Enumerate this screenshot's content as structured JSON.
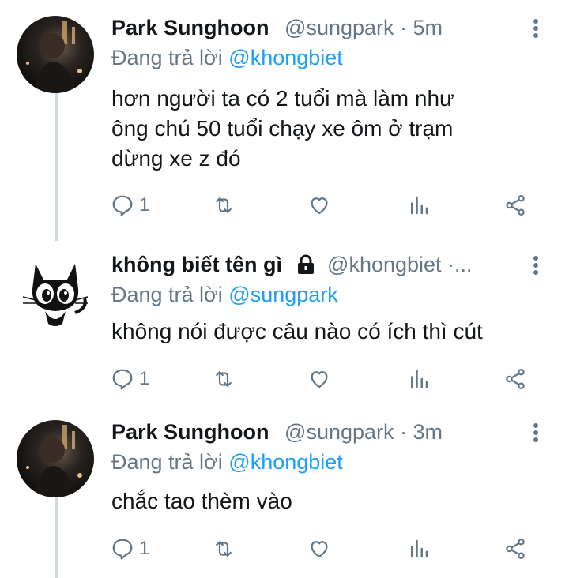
{
  "colors": {
    "accent": "#1da1f2",
    "muted": "#657786",
    "text": "#14171a",
    "thread": "#cfd9de"
  },
  "tweets": [
    {
      "name": "Park Sunghoon",
      "handle": "@sungpark · 5m",
      "reply_prefix": "Đang trả lời",
      "reply_to": "@khongbiet",
      "lines": [
        "hơn người ta có 2 tuổi mà làm như",
        "ông chú 50 tuổi chạy xe ôm ở trạm",
        "dừng xe z đó"
      ],
      "reply_count": "1",
      "avatar": "photo"
    },
    {
      "name": "không biết tên gì",
      "handle": "@khongbiet ·...",
      "reply_prefix": "Đang trả lời",
      "reply_to": "@sungpark",
      "lines": [
        "không nói được câu nào có ích thì cút"
      ],
      "reply_count": "1",
      "avatar": "cat",
      "locked_icon": "lock-icon"
    },
    {
      "name": "Park Sunghoon",
      "handle": "@sungpark · 3m",
      "reply_prefix": "Đang trả lời",
      "reply_to": "@khongbiet",
      "lines": [
        "chắc tao thèm vào"
      ],
      "reply_count": "1",
      "avatar": "photo"
    }
  ]
}
